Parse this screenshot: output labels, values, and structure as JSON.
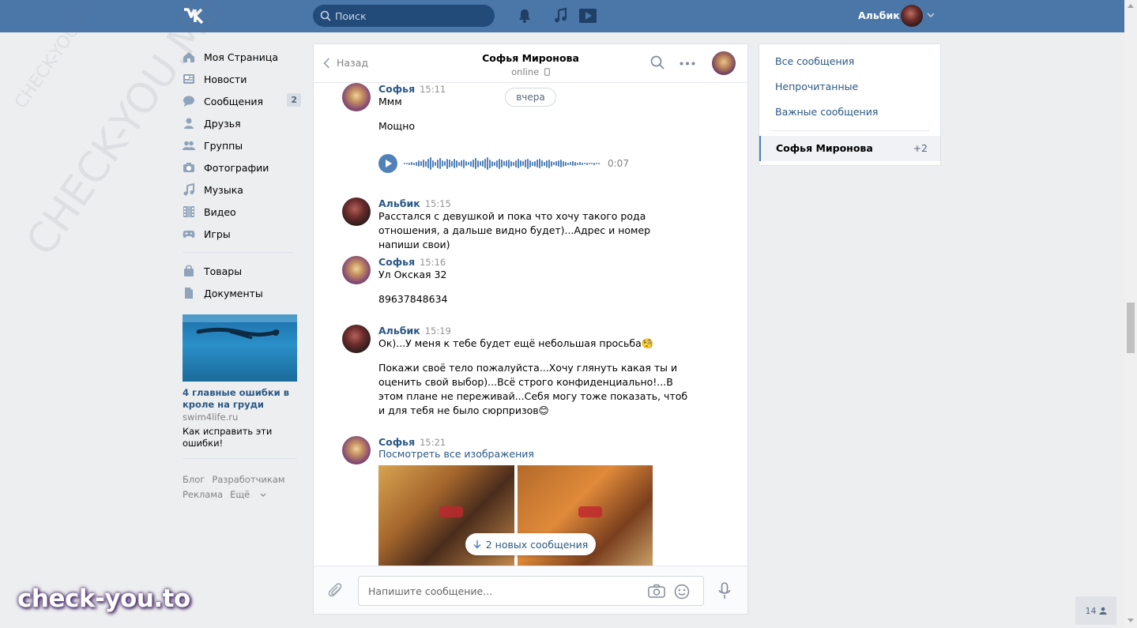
{
  "header": {
    "logo": "VK",
    "search_placeholder": "Поиск",
    "user_name": "Альбик",
    "icons": [
      "bell-icon",
      "music-icon",
      "video-icon",
      "chevron-down-icon"
    ]
  },
  "sidebar": {
    "items": [
      {
        "label": "Моя Страница",
        "icon": "home-icon"
      },
      {
        "label": "Новости",
        "icon": "news-icon"
      },
      {
        "label": "Сообщения",
        "icon": "messages-icon",
        "badge": "2"
      },
      {
        "label": "Друзья",
        "icon": "friends-icon"
      },
      {
        "label": "Группы",
        "icon": "groups-icon"
      },
      {
        "label": "Фотографии",
        "icon": "camera-icon"
      },
      {
        "label": "Музыка",
        "icon": "music-icon"
      },
      {
        "label": "Видео",
        "icon": "film-icon"
      },
      {
        "label": "Игры",
        "icon": "gamepad-icon"
      }
    ],
    "items2": [
      {
        "label": "Товары",
        "icon": "bag-icon"
      },
      {
        "label": "Документы",
        "icon": "document-icon"
      }
    ],
    "ad": {
      "title": "4 главные ошибки в кроле на груди",
      "domain": "swim4life.ru",
      "description": "Как исправить эти ошибки!"
    },
    "footer": {
      "blog": "Блог",
      "developers": "Разработчикам",
      "ads": "Реклама",
      "more": "Ещё"
    }
  },
  "chat": {
    "back_label": "Назад",
    "name": "Софья Миронова",
    "status": "online",
    "date_pill": "вчера",
    "messages": [
      {
        "author": "Софья",
        "time": "15:11",
        "lines": [
          "Ммм",
          "Мощно"
        ],
        "voice_duration": "0:07"
      },
      {
        "author": "Альбик",
        "time": "15:15",
        "text": "Расстался с девушкой и пока что хочу такого рода отношения, а дальше видно будет)...Адрес и номер напиши свои)"
      },
      {
        "author": "Софья",
        "time": "15:16",
        "lines": [
          "Ул Окская 32",
          "89637848634"
        ]
      },
      {
        "author": "Альбик",
        "time": "15:19",
        "text1": "Ок)...У меня к тебе будет ещё небольшая просьба🧐",
        "text2": "Покажи своё тело пожалуйста...Хочу глянуть какая ты и оценить свой выбор)...Всё строго конфиденциально!...В этом плане не переживай...Себя могу тоже показать, чтоб и для тебя не было сюрпризов😊"
      },
      {
        "author": "Софья",
        "time": "15:21",
        "link": "Посмотреть все изображения"
      }
    ],
    "new_messages_pill": "2 новых сообщения",
    "composer_placeholder": "Напишите сообщение..."
  },
  "folders": {
    "all": "Все сообщения",
    "unread": "Непрочитанные",
    "important": "Важные сообщения",
    "active_conversation": "Софья Миронова",
    "active_count": "+2"
  },
  "online_count": "14",
  "watermark": {
    "main": "CHECK-YOU.ME",
    "brand": "check-you.to"
  },
  "colors": {
    "header_bg": "#4a76a8",
    "link": "#2a5885",
    "accent": "#5181b8",
    "page_bg": "#edeef0"
  }
}
